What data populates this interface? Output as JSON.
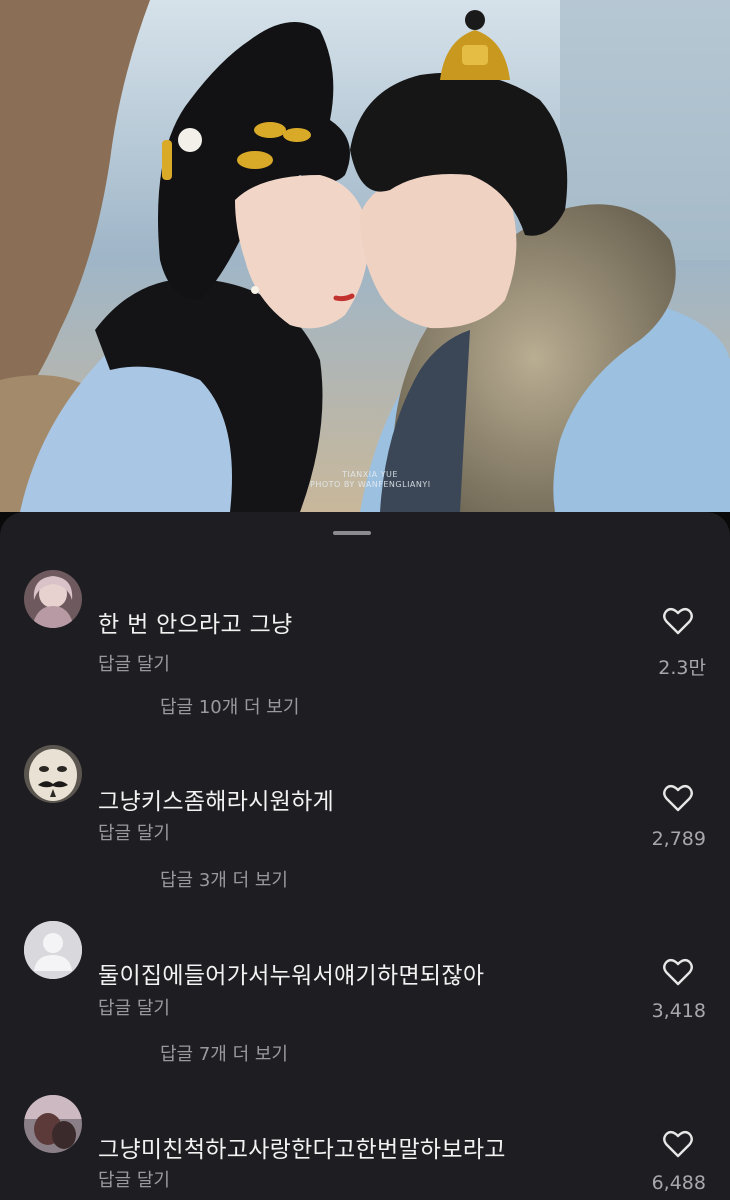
{
  "photo": {
    "watermark_line1": "TIANXIA YUE",
    "watermark_line2": "PHOTO BY WANFENGLIANYI"
  },
  "comments": [
    {
      "avatar": "avatar-photo-icon",
      "text": "한 번 안으라고 그냥",
      "reply_label": "답글 달기",
      "more_replies": "답글 10개 더 보기",
      "likes": "2.3만"
    },
    {
      "avatar": "avatar-mask-icon",
      "text": "그냥키스좀해라시원하게",
      "reply_label": "답글 달기",
      "more_replies": "답글 3개 더 보기",
      "likes": "2,789"
    },
    {
      "avatar": "default-user-icon",
      "text": "둘이집에들어가서누워서얘기하면되잖아",
      "reply_label": "답글 달기",
      "more_replies": "답글 7개 더 보기",
      "likes": "3,418"
    },
    {
      "avatar": "avatar-photo-icon",
      "text": "그냥미친척하고사랑한다고한번말하보라고",
      "reply_label": "답글 달기",
      "more_replies": "",
      "likes": "6,488"
    }
  ],
  "colors": {
    "sheet_background": "#1e1e22",
    "primary_text": "#f2f2f2",
    "secondary_text": "#9a9a9e"
  }
}
